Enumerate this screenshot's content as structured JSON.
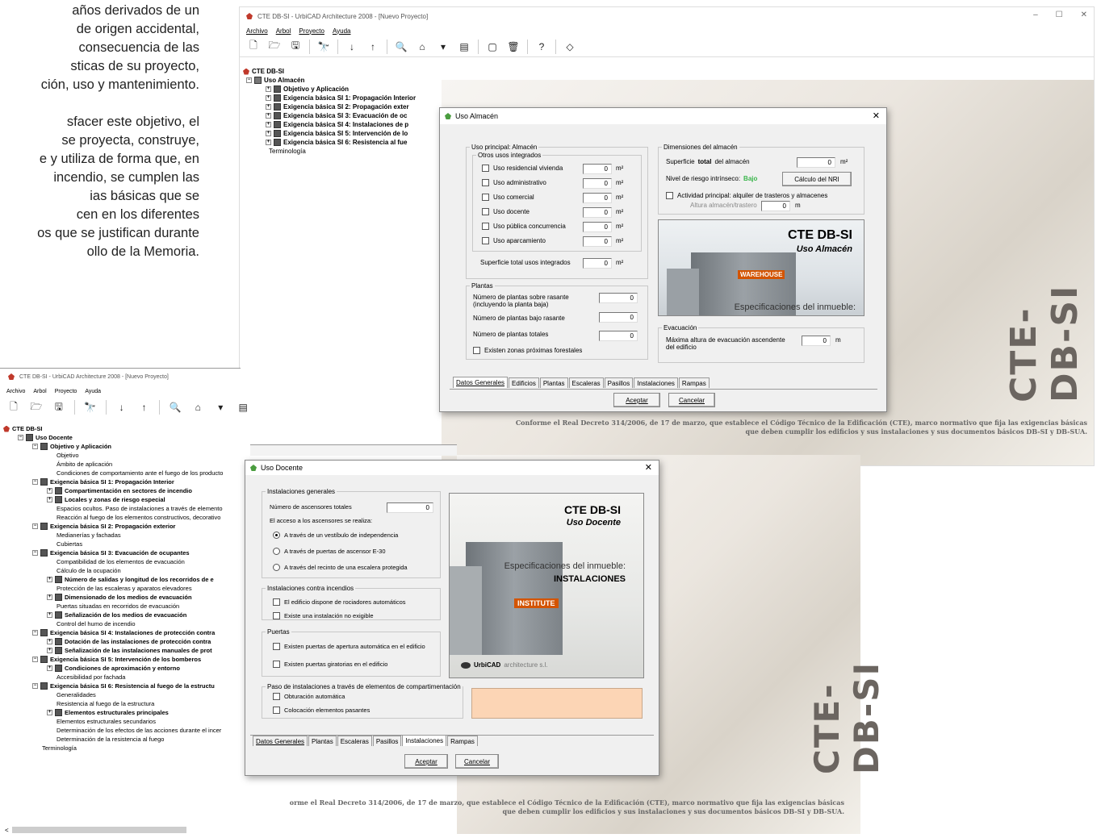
{
  "paper": {
    "lines": [
      "años derivados de un",
      "de origen accidental,",
      "consecuencia de las",
      "sticas de su proyecto,",
      "ción, uso y mantenimiento.",
      "",
      "sfacer este objetivo, el",
      "se proyecta, construye,",
      "e y utiliza de forma que, en",
      "incendio, se cumplen las",
      "ias básicas que se",
      "cen en los diferentes",
      "os que se justifican durante",
      "ollo de la Memoria."
    ]
  },
  "win1": {
    "title": "CTE DB-SI - UrbiCAD Architecture 2008 - [Nuevo Proyecto]",
    "menu": [
      "Archivo",
      "Arbol",
      "Proyecto",
      "Ayuda"
    ],
    "controls": [
      "–",
      "☐",
      "✕"
    ],
    "tree_root": "CTE DB-SI",
    "tree_child": "Uso Almacén",
    "tree_items": [
      "Objetivo y Aplicación",
      "Exigencia básica SI 1: Propagación Interior",
      "Exigencia básica SI 2: Propagación exter",
      "Exigencia básica SI 3: Evacuación de oc",
      "Exigencia básica SI 4: Instalaciones de p",
      "Exigencia básica SI 5: Intervención de lo",
      "Exigencia básica SI 6: Resistencia al fue"
    ],
    "tree_last": "Terminología",
    "watermark": "CTE-DB-SI",
    "footer": "Conforme el Real Decreto 314/2006, de 17 de marzo, que establece el Código Técnico de la Edificación (CTE), marco normativo que fija las exigencias básicas",
    "footer2": "que deben cumplir los edificios y sus instalaciones y sus documentos básicos DB-SI y DB-SUA."
  },
  "dlg1": {
    "title": "Uso Almacén",
    "close": "✕",
    "uso_principal": "Uso principal: Almacén",
    "otros_legend": "Otros usos integrados",
    "usos": [
      "Uso residencial vivienda",
      "Uso administrativo",
      "Uso comercial",
      "Uso docente",
      "Uso pública concurrencia",
      "Uso aparcamiento"
    ],
    "uso_value": "0",
    "unit_m2": "m²",
    "sup_total_label": "Superficie total usos integrados",
    "plantas_legend": "Plantas",
    "plantas_sobre": "Número de plantas sobre rasante",
    "plantas_sobre2": "(incluyendo la planta baja)",
    "plantas_bajo": "Número de plantas bajo rasante",
    "plantas_tot": "Número de plantas totales",
    "forestales": "Existen zonas próximas forestales",
    "dim_legend": "Dimensiones del almacén",
    "sup_label_a": "Superficie",
    "sup_label_b": "total",
    "sup_label_c": "del almacén",
    "nri_label": "Nivel de riesgo intrínseco:",
    "nri_value": "Bajo",
    "nri_button": "Cálculo del NRI",
    "actividad": "Actividad principal: alquiler de trasteros y almacenes",
    "altura_trastero": "Altura almacén/trastero",
    "unit_m": "m",
    "img_title": "CTE DB-SI",
    "img_sub": "Uso Almacén",
    "img_sign": "WAREHOUSE",
    "img_spec": "Especificaciones del inmueble:",
    "evac_legend": "Evacuación",
    "evac_label": "Máxima altura de evacuación ascendente",
    "evac_label2": "del edificio",
    "tabs": [
      "Datos Generales",
      "Edificios",
      "Plantas",
      "Escaleras",
      "Pasillos",
      "Instalaciones",
      "Rampas"
    ],
    "accept": "Aceptar",
    "cancel": "Cancelar"
  },
  "win2": {
    "title": "CTE DB-SI - UrbiCAD Architecture 2008 - [Nuevo Proyecto]",
    "menu": [
      "Archivo",
      "Arbol",
      "Proyecto",
      "Ayuda"
    ],
    "tree": [
      {
        "t": "CTE DB-SI",
        "l": 0,
        "b": true
      },
      {
        "t": "Uso Docente",
        "l": 1,
        "b": true
      },
      {
        "t": "Objetivo y Aplicación",
        "l": 2,
        "b": true
      },
      {
        "t": "Objetivo",
        "l": 3
      },
      {
        "t": "Ámbito de aplicación",
        "l": 3
      },
      {
        "t": "Condiciones de comportamiento ante el fuego de los producto",
        "l": 3
      },
      {
        "t": "Exigencia básica SI 1: Propagación Interior",
        "l": 2,
        "b": true
      },
      {
        "t": "Compartimentación en sectores de incendio",
        "l": 3,
        "b": true
      },
      {
        "t": "Locales y zonas de riesgo especial",
        "l": 3,
        "b": true
      },
      {
        "t": "Espacios ocultos. Paso de instalaciones a través de elemento",
        "l": 3
      },
      {
        "t": "Reacción al fuego de los elementos constructivos, decorativo",
        "l": 3
      },
      {
        "t": "Exigencia básica SI 2: Propagación exterior",
        "l": 2,
        "b": true
      },
      {
        "t": "Medianerías y fachadas",
        "l": 3
      },
      {
        "t": "Cubiertas",
        "l": 3
      },
      {
        "t": "Exigencia básica SI 3: Evacuación de ocupantes",
        "l": 2,
        "b": true
      },
      {
        "t": "Compatibilidad de los elementos de evacuación",
        "l": 3
      },
      {
        "t": "Cálculo de la ocupación",
        "l": 3
      },
      {
        "t": "Número de salidas y longitud de los recorridos de e",
        "l": 3,
        "b": true
      },
      {
        "t": "Protección de las escaleras y aparatos elevadores",
        "l": 3
      },
      {
        "t": "Dimensionado de los medios de evacuación",
        "l": 3,
        "b": true
      },
      {
        "t": "Puertas situadas en recorridos de evacuación",
        "l": 3
      },
      {
        "t": "Señalización de los medios de evacuación",
        "l": 3,
        "b": true
      },
      {
        "t": "Control del humo de incendio",
        "l": 3
      },
      {
        "t": "Exigencia básica SI 4: Instalaciones de protección contra",
        "l": 2,
        "b": true
      },
      {
        "t": "Dotación de las instalaciones de protección contra",
        "l": 3,
        "b": true
      },
      {
        "t": "Señalización de las instalaciones manuales de prot",
        "l": 3,
        "b": true
      },
      {
        "t": "Exigencia básica SI 5: Intervención de los bomberos",
        "l": 2,
        "b": true
      },
      {
        "t": "Condiciones de aproximación y entorno",
        "l": 3,
        "b": true
      },
      {
        "t": "Accesibilidad por fachada",
        "l": 3
      },
      {
        "t": "Exigencia básica SI 6: Resistencia al fuego de la estructu",
        "l": 2,
        "b": true
      },
      {
        "t": "Generalidades",
        "l": 3
      },
      {
        "t": "Resistencia al fuego de la estructura",
        "l": 3
      },
      {
        "t": "Elementos estructurales principales",
        "l": 3,
        "b": true
      },
      {
        "t": "Elementos estructurales secundarios",
        "l": 3
      },
      {
        "t": "Determinación de los efectos de las acciones durante el incer",
        "l": 3
      },
      {
        "t": "Determinación de la resistencia al fuego",
        "l": 3
      },
      {
        "t": "Terminología",
        "l": 2
      }
    ],
    "scroll_left": "<",
    "scroll_right": ">",
    "watermark": "CTE-DB-SI",
    "footer": "orme el Real Decreto 314/2006, de 17 de marzo, que establece el Código Técnico de la Edificación (CTE), marco normativo que fija las exigencias básicas",
    "footer2": "que deben cumplir los edificios y sus instalaciones y sus documentos básicos DB-SI y DB-SUA."
  },
  "dlg2": {
    "title": "Uso Docente",
    "close": "✕",
    "inst_gen": "Instalaciones generales",
    "num_asc": "Número de ascensores totales",
    "num_asc_val": "0",
    "acceso": "El acceso a los ascensores se realiza:",
    "radios": [
      "A través de un vestíbulo de independencia",
      "A través de puertas de ascensor E-30",
      "A través del recinto de una escalera protegida"
    ],
    "inst_inc": "Instalaciones contra incendios",
    "inc_items": [
      "El edificio dispone de rociadores automáticos",
      "Existe una instalación no exigible"
    ],
    "puertas": "Puertas",
    "puertas_items": [
      "Existen puertas de apertura automática en el edificio",
      "Existen puertas giratorias en el edificio"
    ],
    "paso": "Paso de instalaciones a través de elementos de compartimentación",
    "paso_items": [
      "Obturación automática",
      "Colocación elementos pasantes"
    ],
    "img_title": "CTE DB-SI",
    "img_sub": "Uso Docente",
    "img_spec": "Especificaciones del inmueble:",
    "img_inst": "INSTALACIONES",
    "img_sign": "INSTITUTE",
    "img_logo": "UrbiCAD",
    "img_logo2": "architecture s.l.",
    "tabs": [
      "Datos Generales",
      "Plantas",
      "Escaleras",
      "Pasillos",
      "Instalaciones",
      "Rampas"
    ],
    "accept": "Aceptar",
    "cancel": "Cancelar"
  },
  "colors": {
    "accent_green": "#39b54a",
    "peach": "#fcd5b5"
  }
}
